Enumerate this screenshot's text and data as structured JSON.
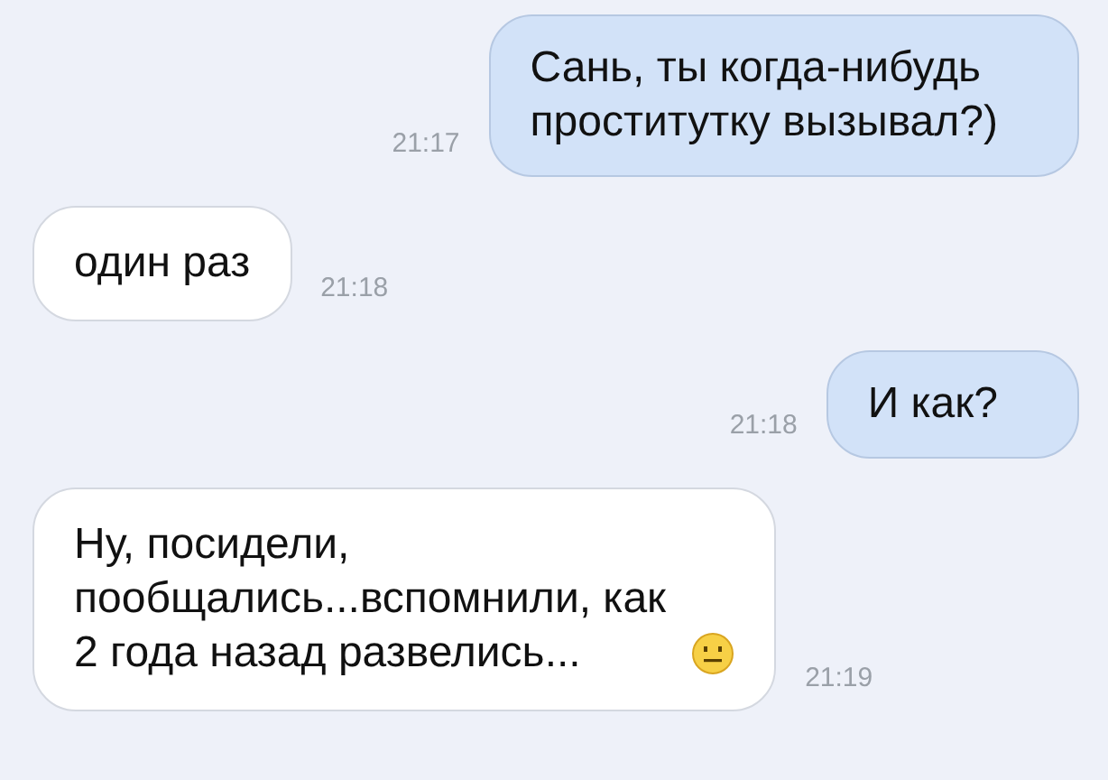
{
  "messages": [
    {
      "kind": "out",
      "lines": [
        "Сань, ты когда-нибудь",
        "проститутку вызывал?)"
      ],
      "time": "21:17",
      "has_emoji": false
    },
    {
      "kind": "in",
      "lines": [
        "один раз"
      ],
      "time": "21:18",
      "has_emoji": false
    },
    {
      "kind": "out",
      "lines": [
        "И как?"
      ],
      "time": "21:18",
      "has_emoji": false
    },
    {
      "kind": "in",
      "lines": [
        "Ну, посидели,",
        "пообщались...вспомнили, как",
        "2 года назад развелись..."
      ],
      "time": "21:19",
      "has_emoji": true
    }
  ]
}
